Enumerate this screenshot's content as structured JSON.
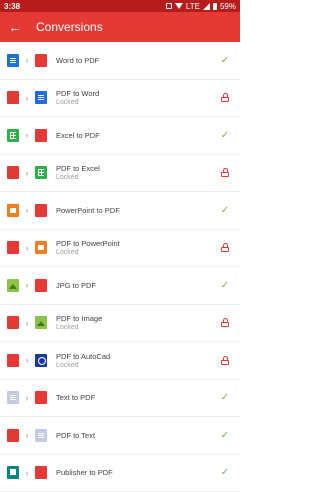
{
  "status_bar": {
    "time": "3:38",
    "network": "LTE",
    "battery": "59%"
  },
  "app_bar": {
    "title": "Conversions",
    "back_icon": "arrow-left-icon"
  },
  "conversions": [
    {
      "label": "Word to PDF",
      "sub": "",
      "from": "word",
      "to": "pdf",
      "status": "check"
    },
    {
      "label": "PDF to Word",
      "sub": "Locked",
      "from": "pdf",
      "to": "word",
      "status": "lock"
    },
    {
      "label": "Excel to PDF",
      "sub": "",
      "from": "excel",
      "to": "pdf",
      "status": "check"
    },
    {
      "label": "PDF to Excel",
      "sub": "Locked",
      "from": "pdf",
      "to": "excel",
      "status": "lock"
    },
    {
      "label": "PowerPoint to PDF",
      "sub": "",
      "from": "ppt",
      "to": "pdf",
      "status": "check"
    },
    {
      "label": "PDF to PowerPoint",
      "sub": "Locked",
      "from": "pdf",
      "to": "ppt",
      "status": "lock"
    },
    {
      "label": "JPG to PDF",
      "sub": "",
      "from": "jpg",
      "to": "pdf",
      "status": "check"
    },
    {
      "label": "PDF to Image",
      "sub": "Locked",
      "from": "pdf",
      "to": "jpg",
      "status": "lock"
    },
    {
      "label": "PDF to AutoCad",
      "sub": "Locked",
      "from": "pdf",
      "to": "cad",
      "status": "lock"
    },
    {
      "label": "Text to PDF",
      "sub": "",
      "from": "text",
      "to": "pdf",
      "status": "check"
    },
    {
      "label": "PDF to Text",
      "sub": "",
      "from": "pdf",
      "to": "text",
      "status": "check"
    },
    {
      "label": "Publisher to PDF",
      "sub": "",
      "from": "pub",
      "to": "pdf",
      "status": "check"
    }
  ],
  "colors": {
    "app_bar": "#e53935",
    "status_bar": "#b71c1c",
    "check": "#7cb342",
    "lock": "#e53935"
  }
}
